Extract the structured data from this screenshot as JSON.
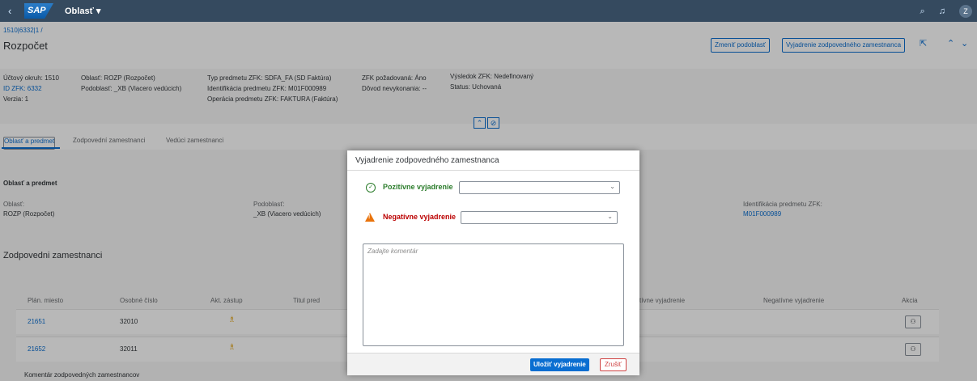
{
  "shell": {
    "back_icon": "‹",
    "logo": "SAP",
    "area": "Oblasť ▾",
    "avatar": "Z"
  },
  "header": {
    "breadcrumb": "1510|6332|1 /",
    "title": "Rozpočet",
    "btn_change": "Zmeniť podoblasť",
    "btn_statement": "Vyjadrenie zodpovedného zamestnanca"
  },
  "facets": {
    "col1": [
      "Účtový okruh: 1510",
      "ID ZFK: 6332",
      "Verzia: 1"
    ],
    "col2": [
      "Oblasť: ROZP (Rozpočet)",
      "Podoblasť: _XB (Viacero vedúcich)"
    ],
    "col3": [
      "Typ predmetu ZFK: SDFA_FA (SD Faktúra)",
      "Identifikácia predmetu ZFK: M01F000989",
      "Operácia predmetu ZFK: FAKTURA (Faktúra)"
    ],
    "col4": [
      "ZFK požadovaná: Áno",
      "Dôvod nevykonania: --"
    ],
    "col5": [
      "Výsledok ZFK: Nedefinovaný",
      "Status: Uchovaná"
    ]
  },
  "tabs": [
    "Oblasť a predmet",
    "Zodpovední zamestnanci",
    "Vedúci zamestnanci"
  ],
  "section1": {
    "title": "Oblasť a predmet",
    "oblast_label": "Oblasť:",
    "oblast_value": "ROZP (Rozpočet)",
    "podoblast_label": "Podoblasť:",
    "podoblast_value": "_XB (Viacero vedúcich)",
    "ident_label": "Identifikácia predmetu ZFK:",
    "ident_value": "M01F000989"
  },
  "section2": {
    "title": "Zodpovedni zamestnanci",
    "columns": [
      "Plán. miesto",
      "Osobné číslo",
      "Akt. zástup",
      "Titul pred",
      "tívne vyjadrenie",
      "Negatívne vyjadrenie",
      "Akcia"
    ],
    "rows": [
      {
        "plan": "21651",
        "osobne": "32010"
      },
      {
        "plan": "21652",
        "osobne": "32011"
      }
    ],
    "comment_label": "Komentár zodpovedných zamestnancov"
  },
  "dialog": {
    "title": "Vyjadrenie zodpovedného zamestnanca",
    "positive_label": "Pozitívne vyjadrenie",
    "negative_label": "Negatívne vyjadrenie",
    "comment_placeholder": "Zadajte komentár",
    "save_label": "Uložiť vyjadrenie",
    "cancel_label": "Zrušiť"
  },
  "colors": {
    "shell": "#354a5f",
    "accent": "#0a6ed1",
    "positive": "#2b7c2b",
    "negative": "#b00",
    "warning": "#e9730c"
  }
}
